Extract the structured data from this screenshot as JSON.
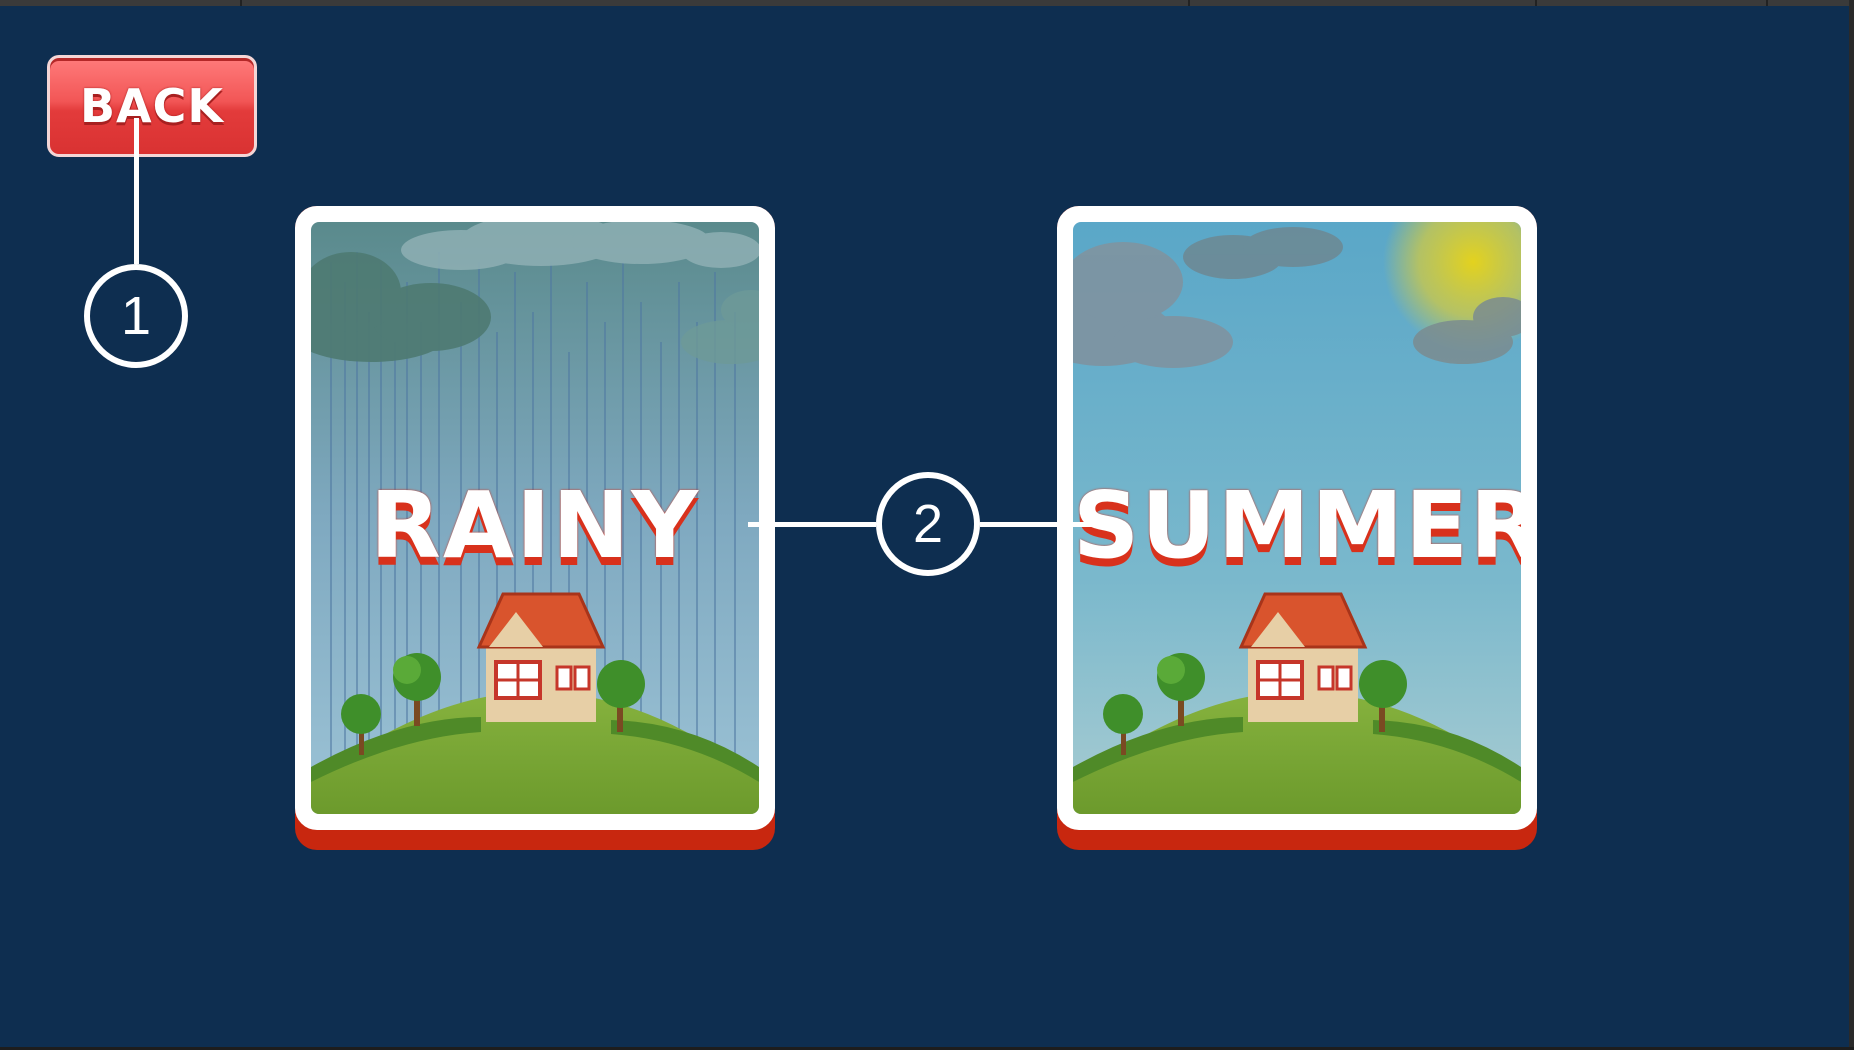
{
  "back_button": {
    "label": "BACK"
  },
  "callouts": [
    {
      "number": "1"
    },
    {
      "number": "2"
    }
  ],
  "cards": [
    {
      "title": "RAINY",
      "scene": "rainy"
    },
    {
      "title": "SUMMER",
      "scene": "summer"
    }
  ],
  "colors": {
    "background": "#0e2e50",
    "back_button": "#e84343",
    "card_border": "#ffffff",
    "card_shadow": "#c8270f",
    "title_shadow": "#d8311c"
  }
}
